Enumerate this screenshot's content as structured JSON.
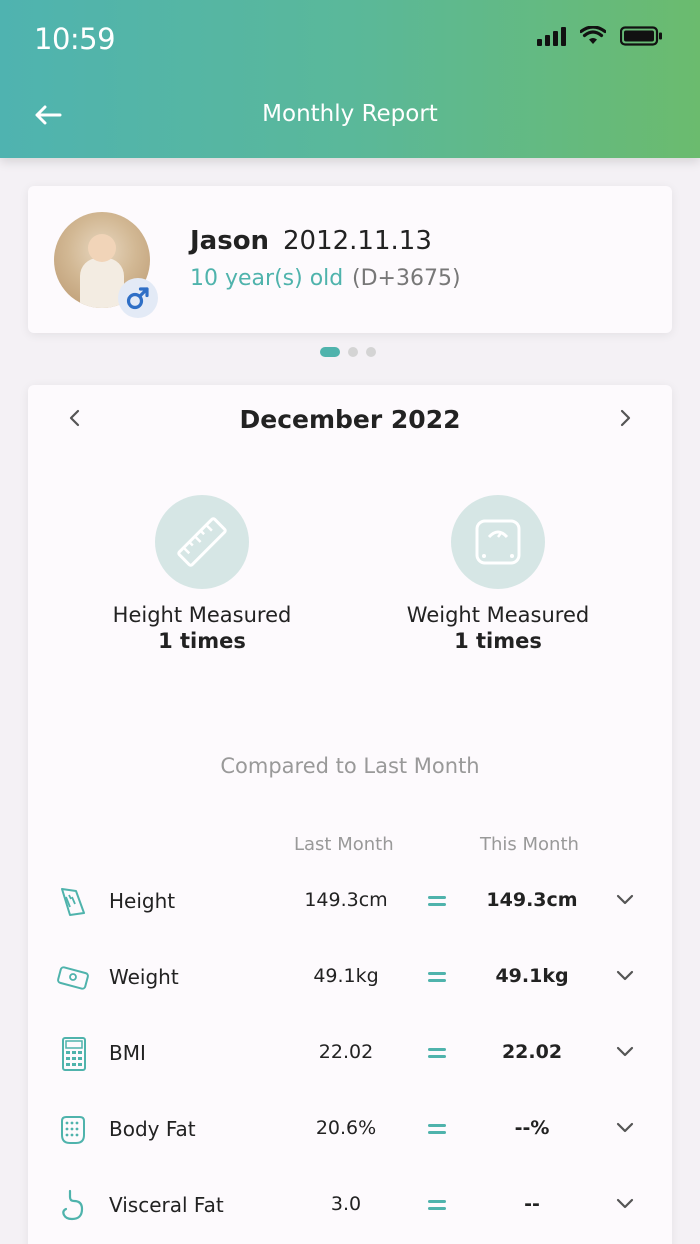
{
  "status": {
    "time": "10:59"
  },
  "nav": {
    "title": "Monthly Report",
    "back_icon": "arrow-left-icon"
  },
  "profile": {
    "name": "Jason",
    "birthdate": "2012.11.13",
    "age": "10 year(s) old",
    "dday": "(D+3675)",
    "gender_icon": "male-icon",
    "accent": "#4fb3ac"
  },
  "pager": {
    "count": 3,
    "active": 0
  },
  "report": {
    "month": "December 2022",
    "height_label": "Height Measured",
    "height_count": "1 times",
    "weight_label": "Weight Measured",
    "weight_count": "1 times",
    "compare_title": "Compared to Last Month",
    "col_last": "Last Month",
    "col_this": "This Month",
    "rows": [
      {
        "name": "Height",
        "last": "149.3cm",
        "this": "149.3cm",
        "icon": "ruler-icon"
      },
      {
        "name": "Weight",
        "last": "49.1kg",
        "this": "49.1kg",
        "icon": "scale-icon"
      },
      {
        "name": "BMI",
        "last": "22.02",
        "this": "22.02",
        "icon": "calculator-icon"
      },
      {
        "name": "Body Fat",
        "last": "20.6%",
        "this": "--%",
        "icon": "body-fat-icon"
      },
      {
        "name": "Visceral Fat",
        "last": "3.0",
        "this": "--",
        "icon": "stomach-icon"
      }
    ]
  },
  "colors": {
    "header_start": "#4fb3b0",
    "header_end": "#6bbb6e",
    "accent": "#4fb3ac"
  }
}
